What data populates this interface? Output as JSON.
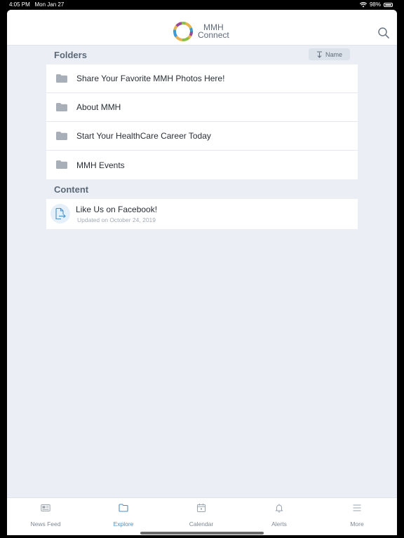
{
  "status_bar": {
    "time": "4:05 PM",
    "date": "Mon Jan 27",
    "battery": "98%"
  },
  "header": {
    "logo_line1": "MMH",
    "logo_line2": "Connect"
  },
  "folders": {
    "title": "Folders",
    "sort_label": "Name",
    "items": [
      {
        "label": "Share Your Favorite MMH Photos Here!"
      },
      {
        "label": "About MMH"
      },
      {
        "label": "Start Your HealthCare Career Today"
      },
      {
        "label": "MMH Events"
      }
    ]
  },
  "content": {
    "title": "Content",
    "items": [
      {
        "title": "Like Us on Facebook!",
        "subtitle": "Updated on October 24, 2019"
      }
    ]
  },
  "tabs": [
    {
      "label": "News Feed",
      "icon": "news-feed-icon"
    },
    {
      "label": "Explore",
      "icon": "folder-icon",
      "active": true
    },
    {
      "label": "Calendar",
      "icon": "calendar-icon"
    },
    {
      "label": "Alerts",
      "icon": "bell-icon"
    },
    {
      "label": "More",
      "icon": "menu-icon"
    }
  ],
  "colors": {
    "accent": "#4d8fc4",
    "background": "#ebeff5",
    "header_text": "#5b6878"
  }
}
